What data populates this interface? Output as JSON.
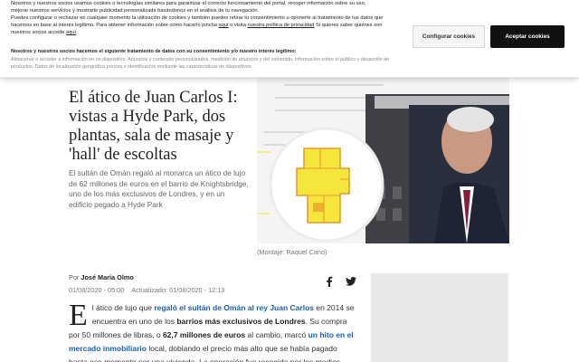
{
  "consent": {
    "para1": "Nosotros y nuestros socios usamos cookies o tecnologías similares para garantizar el correcto funcionamiento del portal, recoger información sobre su uso, mejorar nuestros servicios y mostrarte publicidad personalizada basándonos en el análisis de tu navegación.",
    "para2_a": "Puedes configurar o rechazar en cualquier momento la utilización de cookies y también puedes retirar tu consentimiento u oponerte al tratamiento de tus datos que hacemos en base al interés legítimo. Para obtener información sobre cómo hacerlo pincha ",
    "para2_link1": "aquí",
    "para2_b": " o visita ",
    "para2_link2": "nuestra política de privacidad",
    "para2_c": " Si quieres saber quiénes son nuestros socios accede ",
    "para2_link3": "aquí",
    "para2_d": ".",
    "partners_title": "Nosotros y nuestros socios hacemos el siguiente tratamiento de datos con su consentimiento y/o nuestro interés legítimo:",
    "partners_text": "Almacenar o acceder a información en un dispositivo, Anuncios y contenido personalizados, medición de anuncios y del contenido, información sobre el público y desarrollo de productos, Datos de localización geográfica precisa e identificación mediante las características de dispositivos",
    "configure_label": "Configurar cookies",
    "accept_label": "Aceptar cookies"
  },
  "article": {
    "headline": "El ático de Juan Carlos I: vistas a Hyde Park, dos plantas, sala de masaje y 'hall' de escoltas",
    "lede": "El sultán de Omán regaló al monarca un ático de lujo de 62 millones de euros en el barrio de Knightsbridge, uno de los más exclusivos de Londres, y en un edificio pegado a Hyde Park",
    "caption": "(Montaje: Raquel Cano)",
    "byline_prefix": "Por ",
    "author": "José María Olmo",
    "published": "01/08/2020 - 05:00",
    "updated_label": "Actualizado:",
    "updated": "01/08/2020 - 12:13",
    "dropcap": "E",
    "body": {
      "t1": "l ático de lujo que ",
      "l1": "regaló el sultán de Omán al rey Juan Carlos",
      "t2": " en 2014 se encuentra en uno de los ",
      "b1": "barrios más exclusivos de Londres",
      "t3": ". Su compra por 50 millones de libras, o ",
      "b2": "62,7 millones de euros",
      "t4": " al cambio, marcó ",
      "l2": "un hito en el mercado inmobiliario",
      "t5": " local, doblando el precio más alto que se había pagado hasta ese momento por una vivienda. La operación fue recogida por los medios"
    }
  },
  "colors": {
    "link": "#1b5fae",
    "accept_button": "#111111",
    "plan_yellow": "#f5e63c",
    "plan_orange": "#e89a2a"
  },
  "icons": [
    "facebook-icon",
    "twitter-icon"
  ]
}
